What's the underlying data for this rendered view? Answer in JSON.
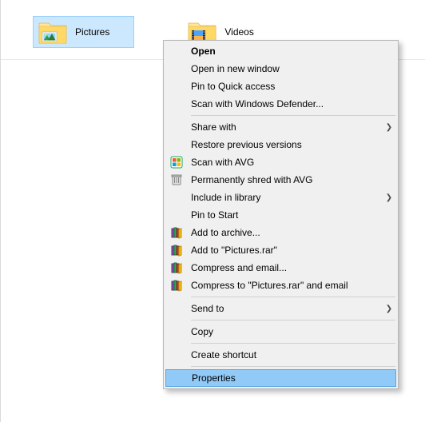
{
  "folders": [
    {
      "label": "Pictures",
      "selected": true,
      "type": "pictures"
    },
    {
      "label": "Videos",
      "selected": false,
      "type": "videos"
    }
  ],
  "menu": {
    "open": "Open",
    "open_new_window": "Open in new window",
    "pin_quick_access": "Pin to Quick access",
    "scan_defender": "Scan with Windows Defender...",
    "share_with": "Share with",
    "restore_previous": "Restore previous versions",
    "scan_avg": "Scan with AVG",
    "shred_avg": "Permanently shred with AVG",
    "include_library": "Include in library",
    "pin_start": "Pin to Start",
    "add_archive": "Add to archive...",
    "add_named_rar": "Add to \"Pictures.rar\"",
    "compress_email": "Compress and email...",
    "compress_named_email": "Compress to \"Pictures.rar\" and email",
    "send_to": "Send to",
    "copy": "Copy",
    "create_shortcut": "Create shortcut",
    "properties": "Properties"
  }
}
